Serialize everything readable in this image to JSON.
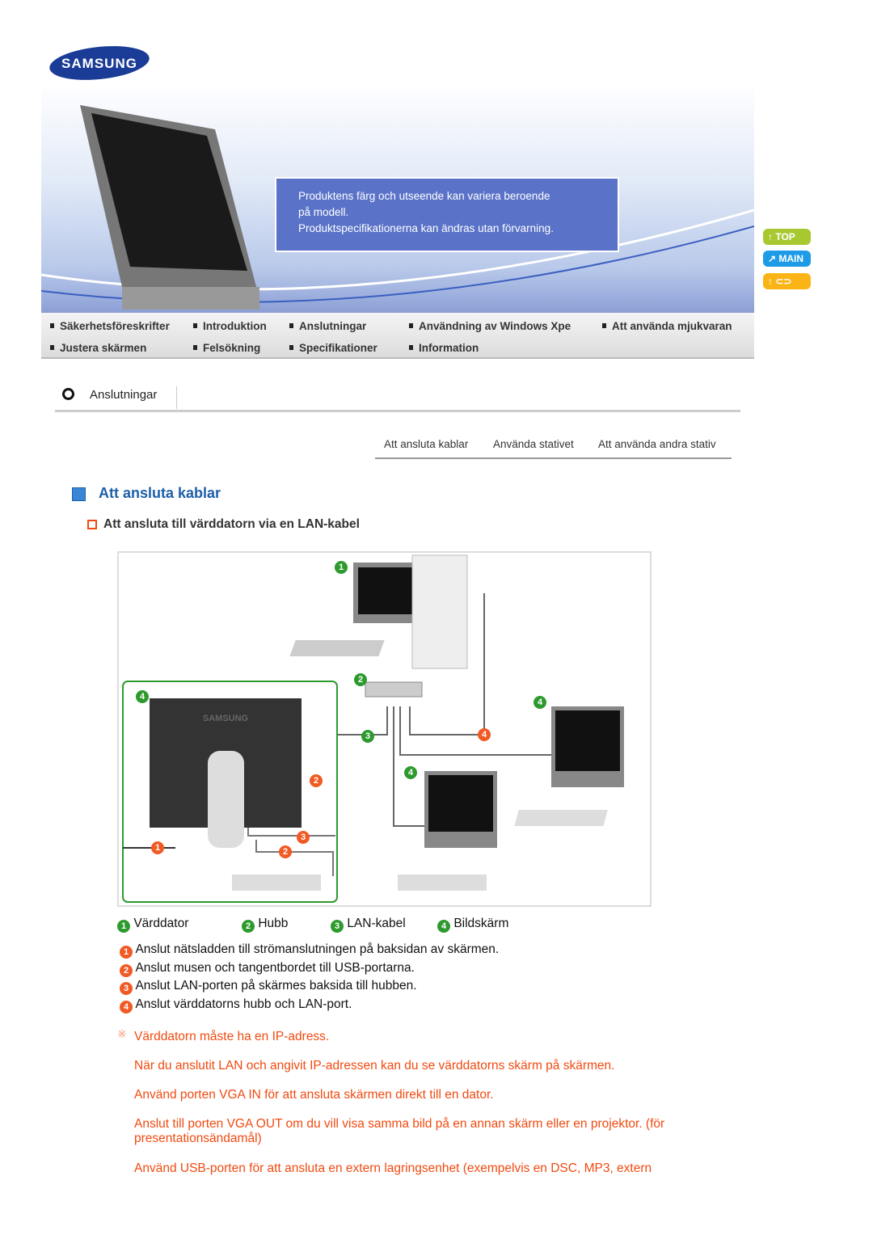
{
  "logo": "SAMSUNG",
  "banner": {
    "notice_lines": [
      "Produktens färg och utseende kan variera beroende",
      "på modell.",
      "Produktspecifikationerna kan ändras utan förvarning."
    ]
  },
  "nav": {
    "row1": [
      "Säkerhetsföreskrifter",
      "Introduktion",
      "Anslutningar",
      "Användning av Windows Xpe",
      "Att använda mjukvaran"
    ],
    "row2": [
      "Justera skärmen",
      "Felsökning",
      "Specifikationer",
      "Information"
    ]
  },
  "side_buttons": [
    {
      "label": "TOP",
      "color": "#a8c832"
    },
    {
      "label": "MAIN",
      "color": "#1e9be6"
    },
    {
      "label": "",
      "color": "#fbb416"
    }
  ],
  "breadcrumb": "Anslutningar",
  "subtabs": [
    "Att ansluta kablar",
    "Använda stativet",
    "Att använda andra stativ"
  ],
  "section_title": "Att ansluta kablar",
  "subsection_title": "Att ansluta till värddatorn via en LAN-kabel",
  "diagram": {
    "brand": "SAMSUNG",
    "markers_green": [
      "1",
      "2",
      "3",
      "4"
    ],
    "markers_orange": [
      "1",
      "2",
      "3",
      "4"
    ]
  },
  "legend": [
    {
      "n": "1",
      "label": "Värddator"
    },
    {
      "n": "2",
      "label": "Hubb"
    },
    {
      "n": "3",
      "label": "LAN-kabel"
    },
    {
      "n": "4",
      "label": "Bildskärm"
    }
  ],
  "steps": [
    {
      "n": "1",
      "text": "Anslut nätsladden till strömanslutningen på baksidan av skärmen."
    },
    {
      "n": "2",
      "text": "Anslut musen och tangentbordet till USB-portarna."
    },
    {
      "n": "3",
      "text": "Anslut LAN-porten på skärmes baksida till hubben."
    },
    {
      "n": "4",
      "text": "Anslut värddatorns hubb och LAN-port."
    }
  ],
  "notes": [
    "Värddatorn måste ha en IP-adress.",
    "När du anslutit LAN och angivit IP-adressen kan du se värddatorns skärm på skärmen.",
    "Använd porten VGA IN för att ansluta skärmen direkt till en dator.",
    "Anslut till porten VGA OUT om du vill visa samma bild på en annan skärm eller en projektor. (för presentationsändamål)",
    "Använd USB-porten för att ansluta en extern lagringsenhet (exempelvis en DSC, MP3, extern"
  ],
  "colors": {
    "accent": "#1d5fa8",
    "note": "#f04a10",
    "marker_green": "#2e9a2e",
    "marker_orange": "#f15a24"
  }
}
